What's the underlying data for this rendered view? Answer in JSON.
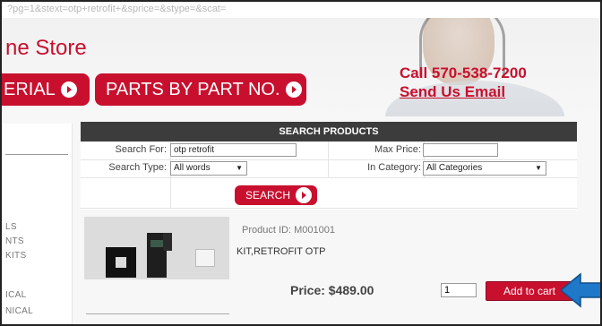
{
  "url_bar": {
    "text": "?pg=1&stext=otp+retrofit+&sprice=&stype=&scat="
  },
  "header": {
    "store_title": "ne Store",
    "serial_label": "ERIAL",
    "part_label": "PARTS BY PART NO.",
    "call_text": "Call 570-538-7200",
    "email_label": "Send Us Email"
  },
  "left_menu": {
    "items": [
      "LS",
      "NTS",
      "KITS",
      "ICAL",
      "NICAL"
    ]
  },
  "search": {
    "header": "SEARCH PRODUCTS",
    "search_for_label": "Search For:",
    "search_for_value": "otp retrofit",
    "max_price_label": "Max Price:",
    "max_price_value": "",
    "search_type_label": "Search Type:",
    "search_type_value": "All words",
    "category_label": "In Category:",
    "category_value": "All Categories",
    "button_label": "SEARCH"
  },
  "product": {
    "id_text": "Product ID: M001001",
    "name": "KIT,RETROFIT OTP",
    "price_text": "Price: $489.00",
    "quantity": "1",
    "cart_button": "Add to cart"
  },
  "colors": {
    "brand": "#c8102e",
    "header_bar": "#3c3c3c",
    "arrow": "#1f78c8"
  },
  "icons": [
    "arrow-right-circle-icon",
    "dropdown-arrow-icon",
    "pointer-arrow-icon"
  ]
}
